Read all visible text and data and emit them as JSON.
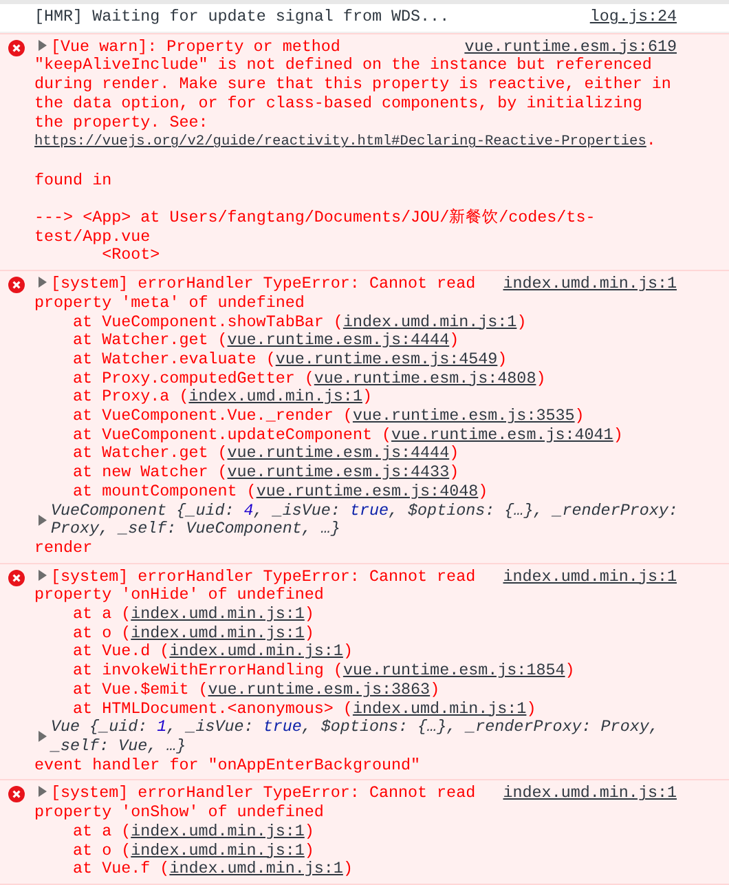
{
  "messages": [
    {
      "kind": "log",
      "text": "[HMR] Waiting for update signal from WDS...",
      "source": "log.js:24"
    },
    {
      "kind": "error",
      "source": "vue.runtime.esm.js:619",
      "text": "[Vue warn]: Property or method",
      "continuation": "\"keepAliveInclude\" is not defined on the instance but referenced during render. Make sure that this property is reactive, either in the data option, or for class-based components, by initializing the property. See: ",
      "link": "https://vuejs.org/v2/guide/reactivity.html#Declaring-Reactive-Properties",
      "after": ".",
      "lines": [
        {
          "kind": "para",
          "text": "found in"
        },
        {
          "kind": "para",
          "text": "---> <App> at Users/fangtang/Documents/JOU/新餐饮/codes/ts-test/App.vue"
        },
        {
          "kind": "tree",
          "text": "<Root>"
        }
      ]
    },
    {
      "kind": "error",
      "source": "index.umd.min.js:1",
      "text": "[system] errorHandler TypeError: Cannot read property 'meta' of undefined",
      "lines": [
        {
          "kind": "frame",
          "before": "at VueComponent.showTabBar (",
          "link": "index.umd.min.js:1",
          "after": ")"
        },
        {
          "kind": "frame",
          "before": "at Watcher.get (",
          "link": "vue.runtime.esm.js:4444",
          "after": ")"
        },
        {
          "kind": "frame",
          "before": "at Watcher.evaluate (",
          "link": "vue.runtime.esm.js:4549",
          "after": ")"
        },
        {
          "kind": "frame",
          "before": "at Proxy.computedGetter (",
          "link": "vue.runtime.esm.js:4808",
          "after": ")"
        },
        {
          "kind": "frame",
          "before": "at Proxy.a (",
          "link": "index.umd.min.js:1",
          "after": ")"
        },
        {
          "kind": "frame",
          "before": "at VueComponent.Vue._render (",
          "link": "vue.runtime.esm.js:3535",
          "after": ")"
        },
        {
          "kind": "frame",
          "before": "at VueComponent.updateComponent (",
          "link": "vue.runtime.esm.js:4041",
          "after": ")"
        },
        {
          "kind": "frame",
          "before": "at Watcher.get (",
          "link": "vue.runtime.esm.js:4444",
          "after": ")"
        },
        {
          "kind": "frame",
          "before": "at new Watcher (",
          "link": "vue.runtime.esm.js:4433",
          "after": ")"
        },
        {
          "kind": "frame",
          "before": "at mountComponent (",
          "link": "vue.runtime.esm.js:4048",
          "after": ")"
        },
        {
          "kind": "object",
          "parts": [
            {
              "kind": "plain",
              "t": "VueComponent {_uid: "
            },
            {
              "kind": "number",
              "t": "4"
            },
            {
              "kind": "plain",
              "t": ", _isVue: "
            },
            {
              "kind": "boolean",
              "t": "true"
            },
            {
              "kind": "plain",
              "t": ", $options: {…}, _renderProxy: Proxy, _self: VueComponent, …}"
            }
          ]
        },
        {
          "kind": "line",
          "text": "render"
        }
      ]
    },
    {
      "kind": "error",
      "source": "index.umd.min.js:1",
      "text": "[system] errorHandler TypeError: Cannot read property 'onHide' of undefined",
      "lines": [
        {
          "kind": "frame",
          "before": "at a (",
          "link": "index.umd.min.js:1",
          "after": ")"
        },
        {
          "kind": "frame",
          "before": "at o (",
          "link": "index.umd.min.js:1",
          "after": ")"
        },
        {
          "kind": "frame",
          "before": "at Vue.d (",
          "link": "index.umd.min.js:1",
          "after": ")"
        },
        {
          "kind": "frame",
          "before": "at invokeWithErrorHandling (",
          "link": "vue.runtime.esm.js:1854",
          "after": ")"
        },
        {
          "kind": "frame",
          "before": "at Vue.$emit (",
          "link": "vue.runtime.esm.js:3863",
          "after": ")"
        },
        {
          "kind": "frame",
          "before": "at HTMLDocument.<anonymous> (",
          "link": "index.umd.min.js:1",
          "after": ")"
        },
        {
          "kind": "object",
          "parts": [
            {
              "kind": "plain",
              "t": "Vue {_uid: "
            },
            {
              "kind": "number",
              "t": "1"
            },
            {
              "kind": "plain",
              "t": ", _isVue: "
            },
            {
              "kind": "boolean",
              "t": "true"
            },
            {
              "kind": "plain",
              "t": ", $options: {…}, _renderProxy: Proxy, _self: Vue, …}"
            }
          ]
        },
        {
          "kind": "line",
          "text": "event handler for \"onAppEnterBackground\""
        }
      ]
    },
    {
      "kind": "error",
      "source": "index.umd.min.js:1",
      "text": "[system] errorHandler TypeError: Cannot read property 'onShow' of undefined",
      "lines": [
        {
          "kind": "frame",
          "before": "at a (",
          "link": "index.umd.min.js:1",
          "after": ")"
        },
        {
          "kind": "frame",
          "before": "at o (",
          "link": "index.umd.min.js:1",
          "after": ")"
        },
        {
          "kind": "frame",
          "before": "at Vue.f (",
          "link": "index.umd.min.js:1",
          "after": ")"
        }
      ]
    }
  ]
}
